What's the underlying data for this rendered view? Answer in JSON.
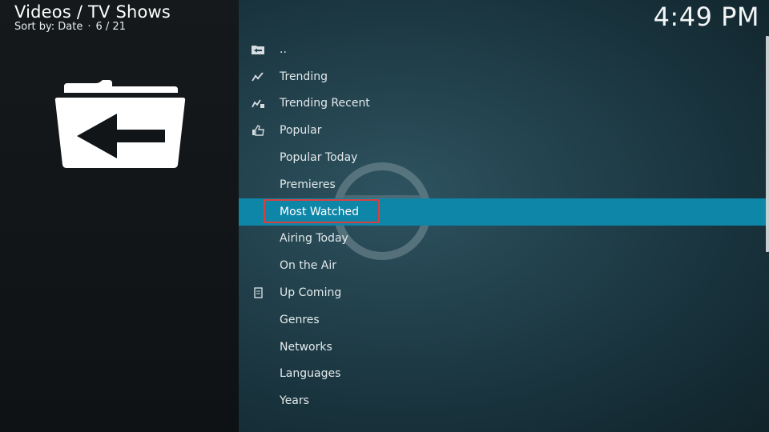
{
  "header": {
    "title": "Videos / TV Shows",
    "sort_label": "Sort by: Date",
    "separator": "·",
    "position": "6 / 21"
  },
  "clock": {
    "time": "4:49 PM"
  },
  "list": {
    "items": [
      {
        "label": "..",
        "icon": "folder-back-icon"
      },
      {
        "label": "Trending",
        "icon": "trending-icon"
      },
      {
        "label": "Trending Recent",
        "icon": "trending-recent-icon"
      },
      {
        "label": "Popular",
        "icon": "thumbs-up-icon"
      },
      {
        "label": "Popular Today",
        "icon": ""
      },
      {
        "label": "Premieres",
        "icon": ""
      },
      {
        "label": "Most Watched",
        "icon": ""
      },
      {
        "label": "Airing Today",
        "icon": ""
      },
      {
        "label": "On the Air",
        "icon": ""
      },
      {
        "label": "Up Coming",
        "icon": "calendar-icon"
      },
      {
        "label": "Genres",
        "icon": ""
      },
      {
        "label": "Networks",
        "icon": ""
      },
      {
        "label": "Languages",
        "icon": ""
      },
      {
        "label": "Years",
        "icon": ""
      }
    ],
    "focused_index": 6
  },
  "thumbnail": {
    "icon": "folder-back-icon"
  },
  "colors": {
    "focus": "#0e86a8",
    "focus_outline": "#d84040"
  }
}
